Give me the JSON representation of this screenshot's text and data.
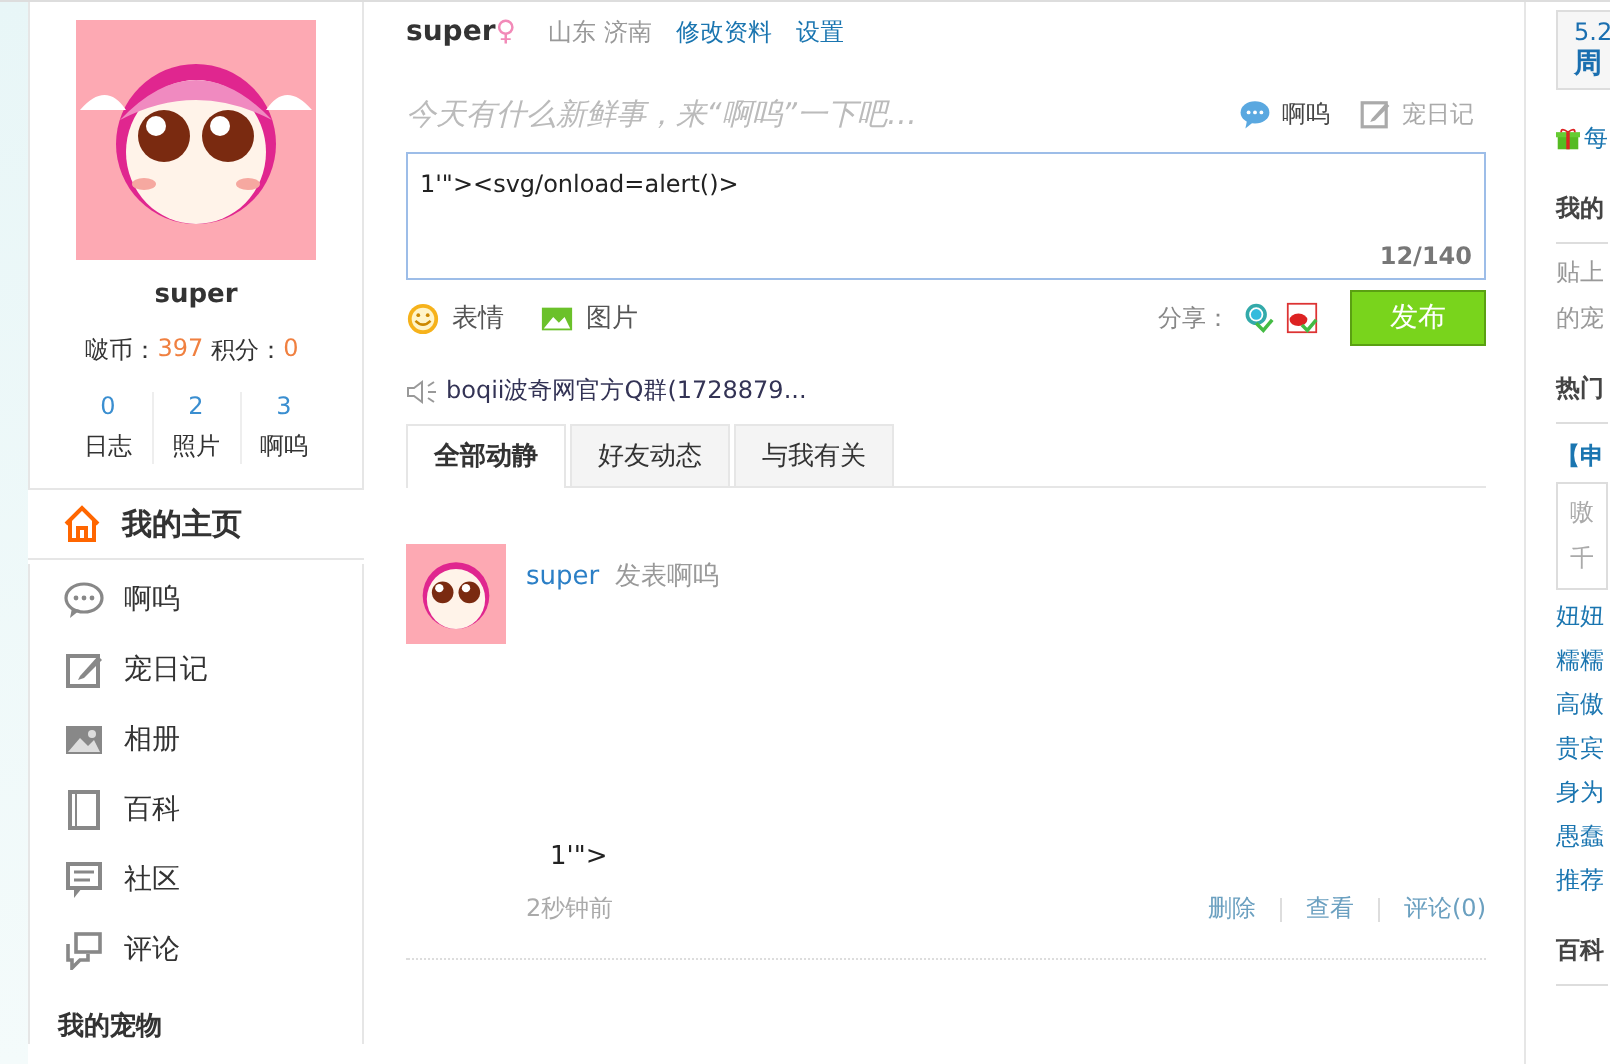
{
  "profile": {
    "name": "super",
    "coins_label": "啵币：",
    "coins": "397",
    "points_label": "积分：",
    "points": "0",
    "stats": [
      {
        "count": "0",
        "label": "日志"
      },
      {
        "count": "2",
        "label": "照片"
      },
      {
        "count": "3",
        "label": "啊呜"
      }
    ]
  },
  "nav": [
    {
      "kind": "home",
      "label": "我的主页",
      "selected": true
    },
    {
      "kind": "chat",
      "label": "啊呜",
      "selected": false
    },
    {
      "kind": "edit",
      "label": "宠日记",
      "selected": false
    },
    {
      "kind": "photo",
      "label": "相册",
      "selected": false
    },
    {
      "kind": "book",
      "label": "百科",
      "selected": false
    },
    {
      "kind": "forum",
      "label": "社区",
      "selected": false
    },
    {
      "kind": "comment",
      "label": "评论",
      "selected": false
    }
  ],
  "nav_footer": "我的宠物",
  "header": {
    "name": "super",
    "gender": "♀",
    "location": "山东 济南",
    "links": [
      "修改资料",
      "设置"
    ]
  },
  "composer": {
    "prompt": "今天有什么新鲜事，来“啊呜”一下吧…",
    "modes": [
      {
        "kind": "chat",
        "label": "啊呜",
        "selected": true
      },
      {
        "kind": "edit",
        "label": "宠日记",
        "selected": false
      }
    ],
    "value": "1'\"><svg/onload=alert()>",
    "counter": "12/140",
    "tools": [
      {
        "kind": "smile",
        "label": "表情"
      },
      {
        "kind": "image",
        "label": "图片"
      }
    ],
    "share_label": "分享：",
    "submit": "发布"
  },
  "notice": "boqii波奇网官方Q群(1728879...",
  "feed_tabs": [
    {
      "label": "全部动静",
      "selected": true
    },
    {
      "label": "好友动态",
      "selected": false
    },
    {
      "label": "与我有关",
      "selected": false
    }
  ],
  "feed": [
    {
      "user": "super",
      "action": "发表啊呜",
      "content": "1'\">",
      "time": "2秒钟前",
      "actions": [
        "删除",
        "查看",
        "评论(0)"
      ]
    }
  ],
  "right": {
    "date": "5.2",
    "weekday": "周",
    "gift": "每",
    "sections": [
      {
        "title": "我的",
        "lines": [
          "贴上",
          "的宠"
        ]
      },
      {
        "title": "热门",
        "lines": [
          "【申"
        ]
      }
    ],
    "quote": [
      "嗷",
      "千"
    ],
    "links": [
      "妞妞",
      "糯糯",
      "高傲",
      "贵宾",
      "身为",
      "愚蠢",
      "推荐"
    ],
    "footer": "百科"
  }
}
